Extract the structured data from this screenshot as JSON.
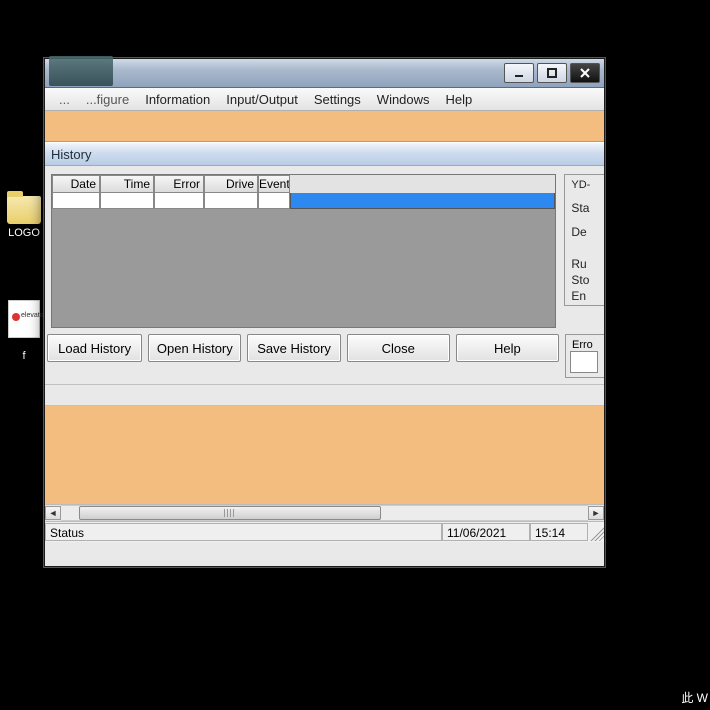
{
  "desktop": {
    "icons": [
      {
        "label": "LOGO"
      },
      {
        "label": "elevator",
        "doc_text": "elevator"
      },
      {
        "label": "f"
      }
    ]
  },
  "window": {
    "menus": {
      "partial1": "...",
      "partial2": "...figure",
      "information": "Information",
      "input_output": "Input/Output",
      "settings": "Settings",
      "windows": "Windows",
      "help": "Help"
    },
    "section_title": "History",
    "grid": {
      "columns": [
        "Date",
        "Time",
        "Error",
        "Drive",
        "Event"
      ]
    },
    "side": {
      "legend_top": "YD-",
      "labels": [
        "Sta",
        "De",
        "Ru",
        "Sto",
        "En"
      ],
      "legend_err": "Erro"
    },
    "buttons": {
      "load": "Load History",
      "open": "Open History",
      "save": "Save History",
      "close": "Close",
      "help": "Help"
    },
    "status": {
      "label": "Status",
      "date": "11/06/2021",
      "time": "15:14"
    }
  },
  "taskbar_fragment": "此 W"
}
